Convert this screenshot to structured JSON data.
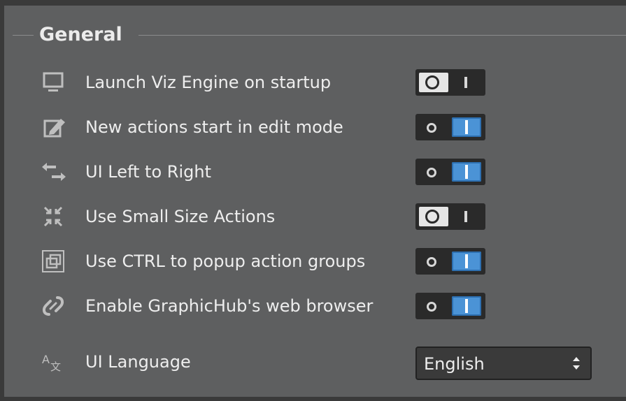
{
  "section": {
    "title": "General"
  },
  "settings": [
    {
      "label": "Launch Viz Engine on startup",
      "enabled": false,
      "icon": "monitor-icon"
    },
    {
      "label": "New actions start in edit mode",
      "enabled": true,
      "icon": "edit-icon"
    },
    {
      "label": "UI Left to Right",
      "enabled": true,
      "icon": "left-right-arrows-icon"
    },
    {
      "label": "Use Small Size Actions",
      "enabled": false,
      "icon": "shrink-arrows-icon"
    },
    {
      "label": "Use CTRL to popup action groups",
      "enabled": true,
      "icon": "layers-icon"
    },
    {
      "label": "Enable GraphicHub's web browser",
      "enabled": true,
      "icon": "link-icon"
    }
  ],
  "language": {
    "label": "UI Language",
    "value": "English",
    "icon": "language-icon"
  },
  "colors": {
    "panel": "#5e5f60",
    "toggle_on": "#4b93d6",
    "toggle_bg": "#2a2a2a"
  }
}
